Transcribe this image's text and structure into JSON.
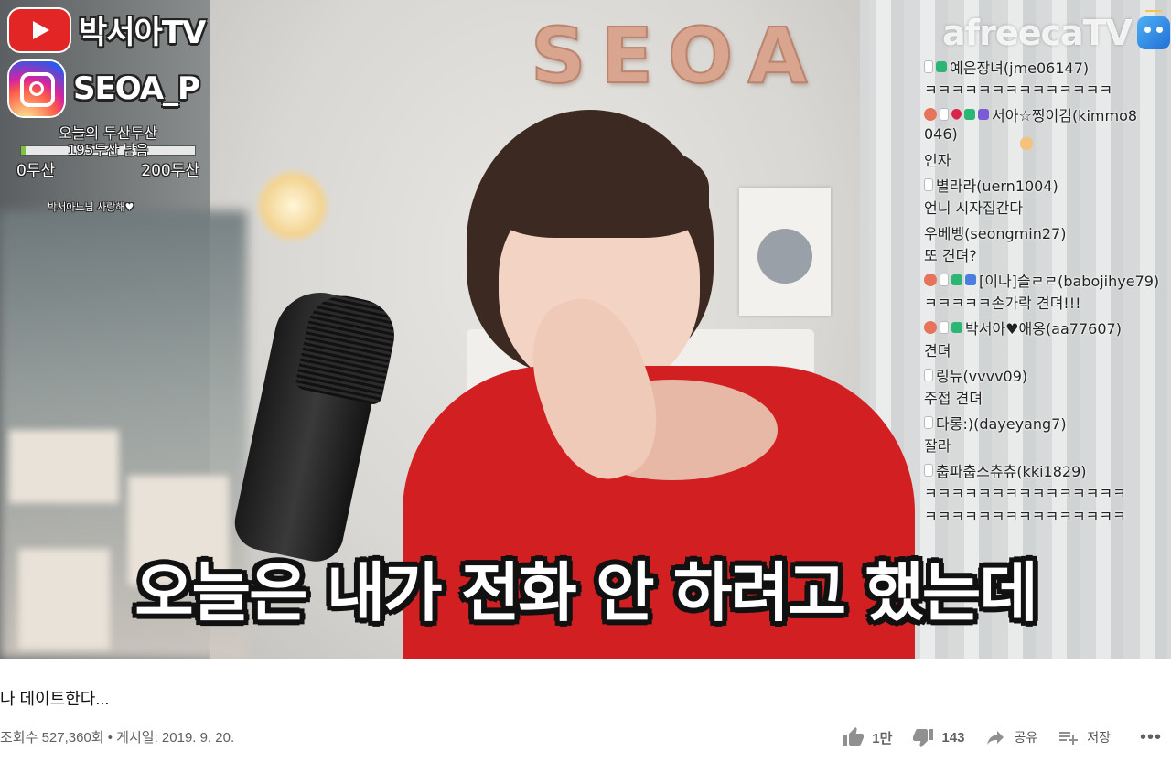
{
  "overlay": {
    "youtube_channel": "박서아TV",
    "instagram_handle": "SEOA_P",
    "goal_title": "오늘의 두산두산",
    "goal_remaining": "195두산 남음",
    "goal_start": "0두산",
    "goal_end": "200두산",
    "goal_progress": 0.025,
    "thanks_note": "박서아느님 사랑해♥",
    "wall_letters": [
      "S",
      "E",
      "O",
      "A"
    ],
    "afreeca_logo": "afreecaTV",
    "subtitle": "오늘은 내가 전화 안 하려고 했는데"
  },
  "chat": [
    {
      "user": "예은장녀(jme06147)",
      "text": "ㅋㅋㅋㅋㅋㅋㅋㅋㅋㅋㅋㅋㅋㅋ",
      "badges": [
        "face",
        "white",
        "green"
      ]
    },
    {
      "user": "서아☆찡이김(kimmo8",
      "user_cont": "046)",
      "text": "인자",
      "badges": [
        "red-face",
        "white",
        "heart",
        "green",
        "purple"
      ],
      "badge_num": "5"
    },
    {
      "user": "별라라(uern1004)",
      "text": "언니 시자집간다",
      "badges": [
        "face",
        "white"
      ]
    },
    {
      "user": "우베벵(seongmin27)",
      "text": "또 견뎌?",
      "badges": [
        "face"
      ]
    },
    {
      "user": "[이나]슬ㄹㄹ(babojihye79)",
      "text": "ㅋㅋㅋㅋㅋ손가락 견뎌!!!",
      "badges": [
        "red-face",
        "white",
        "green",
        "blue"
      ]
    },
    {
      "user": "박서아♥애옹(aa77607)",
      "text": "견뎌",
      "badges": [
        "red-face",
        "white",
        "green"
      ]
    },
    {
      "user": "링뉴(vvvv09)",
      "text": "주접 견뎌",
      "badges": [
        "face",
        "white"
      ]
    },
    {
      "user": "다롱:)(dayeyang7)",
      "text": "잘라",
      "badges": [
        "face",
        "white"
      ]
    },
    {
      "user": "춥파춥스츄츄(kki1829)",
      "text": "ㅋㅋㅋㅋㅋㅋㅋㅋㅋㅋㅋㅋㅋㅋㅋ",
      "text2": "ㅋㅋㅋㅋㅋㅋㅋㅋㅋㅋㅋㅋㅋㅋㅋ",
      "badges": [
        "face",
        "white"
      ]
    }
  ],
  "video": {
    "title": "나 데이트한다...",
    "meta": "조회수 527,360회 • 게시일: 2019. 9. 20.",
    "like_count": "1만",
    "dislike_count": "143",
    "share_label": "공유",
    "save_label": "저장",
    "more_label": "•••"
  },
  "icons": {
    "like": "thumbs-up-icon",
    "dislike": "thumbs-down-icon",
    "share": "share-arrow-icon",
    "save": "playlist-add-icon",
    "more": "more-dots-icon"
  },
  "colors": {
    "youtube_red": "#e22525",
    "sweater_red": "#d21f21",
    "goal_fill": "#7fc241"
  }
}
